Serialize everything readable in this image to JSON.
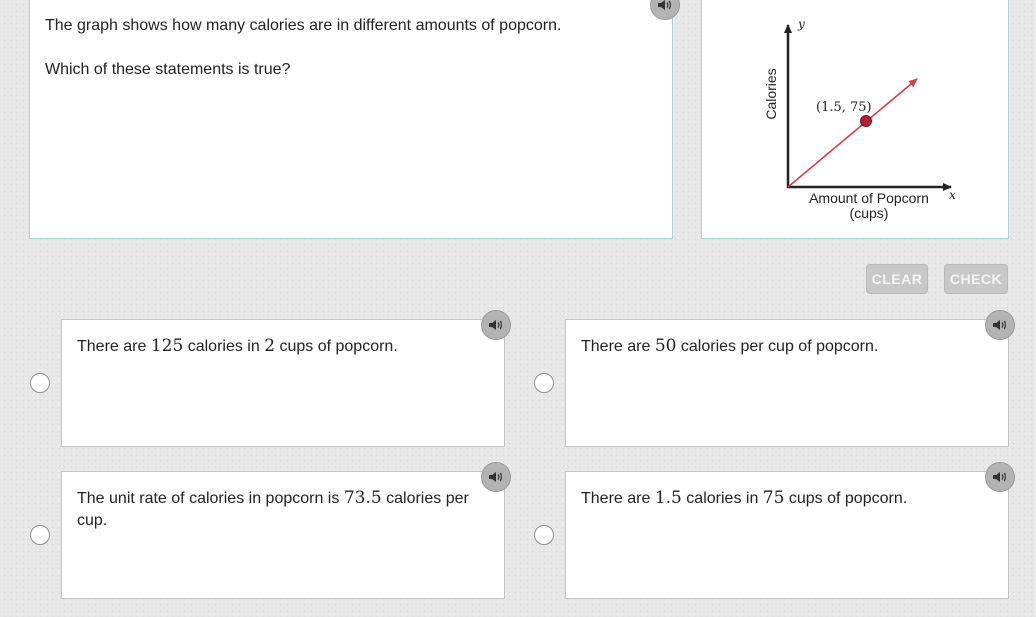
{
  "question": {
    "intro": "The graph shows how many calories are in different amounts of popcorn.",
    "prompt": "Which of these statements is true?"
  },
  "graph": {
    "y_axis_label": "Calories",
    "x_axis_label_line1": "Amount of Popcorn",
    "x_axis_label_line2": "(cups)",
    "x_axis_var": "x",
    "y_axis_var": "y",
    "point_label": "(1.5, 75)",
    "point": {
      "x": 1.5,
      "y": 75
    },
    "line_color": "#d0404a",
    "point_color": "#b0202e"
  },
  "buttons": {
    "clear": "CLEAR",
    "check": "CHECK"
  },
  "choices": [
    {
      "pre": "There are ",
      "num1": "125",
      "mid": " calories in ",
      "num2": "2",
      "post": " cups of popcorn."
    },
    {
      "pre": "There are ",
      "num1": "50",
      "mid": " calories per cup of popcorn.",
      "num2": "",
      "post": ""
    },
    {
      "pre": "The unit rate of calories in popcorn is ",
      "num1": "73.5",
      "mid": " calories per cup.",
      "num2": "",
      "post": ""
    },
    {
      "pre": "There are ",
      "num1": "1.5",
      "mid": " calories in ",
      "num2": "75",
      "post": " cups of popcorn."
    }
  ],
  "icons": {
    "audio": "speaker-icon",
    "radio": "radio-circle"
  }
}
